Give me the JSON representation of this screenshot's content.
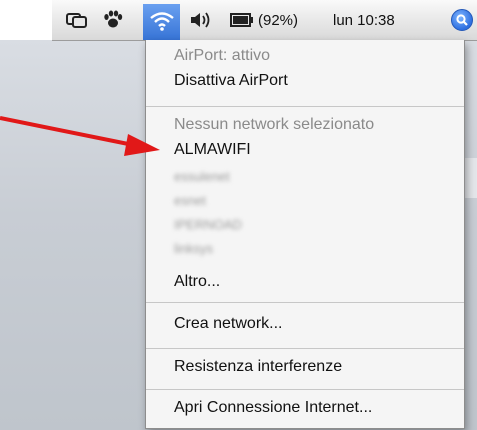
{
  "menubar": {
    "battery_percent": "(92%)",
    "clock": "lun 10:38",
    "icons": [
      "mirror-displays-icon",
      "paw-icon",
      "wifi-icon",
      "volume-icon",
      "battery-icon",
      "spotlight-icon"
    ]
  },
  "airport_menu": {
    "status": "AirPort: attivo",
    "toggle": "Disattiva AirPort",
    "no_network": "Nessun network selezionato",
    "networks": [
      "ALMAWIFI",
      "essulenet",
      "esnet",
      "IPERNOAD",
      "linksys"
    ],
    "other": "Altro...",
    "create_network": "Crea network...",
    "interference": "Resistenza interferenze",
    "open_connect": "Apri Connessione Internet..."
  },
  "colors": {
    "arrow": "#e11818",
    "menu_highlight": "#3774d6"
  }
}
